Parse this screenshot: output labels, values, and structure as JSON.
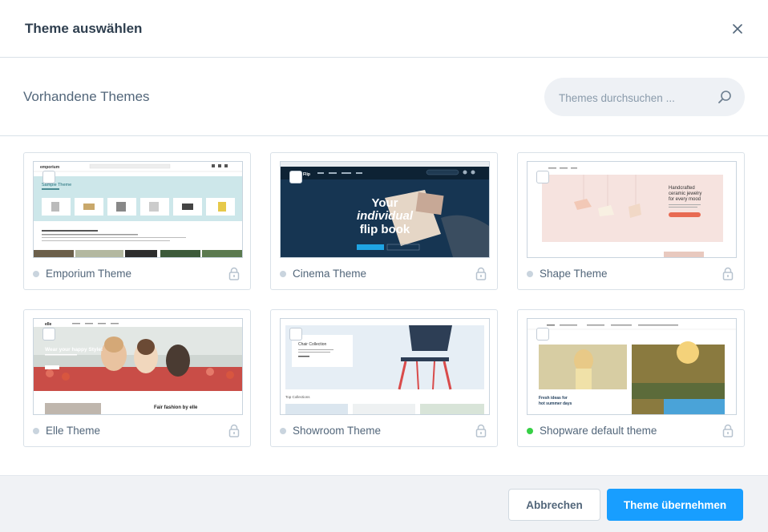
{
  "modal": {
    "title": "Theme auswählen",
    "section_title": "Vorhandene Themes",
    "search": {
      "placeholder": "Themes durchsuchen ..."
    },
    "colors": {
      "primary": "#189eff",
      "active_dot": "#37d046",
      "inactive_dot": "#c9d4de"
    },
    "footer": {
      "cancel_label": "Abbrechen",
      "apply_label": "Theme übernehmen"
    }
  },
  "themes": [
    {
      "name": "Emporium Theme",
      "active": false,
      "locked": true,
      "preview": {
        "logo": "emporium",
        "heading": "Sample Theme"
      }
    },
    {
      "name": "Cinema Theme",
      "active": false,
      "locked": true,
      "preview": {
        "logo": "Flip",
        "line1": "Your",
        "line2": "individual",
        "line3": "flip book"
      }
    },
    {
      "name": "Shape Theme",
      "active": false,
      "locked": true,
      "preview": {
        "line1": "Handcrafted",
        "line2": "ceramic jewelry",
        "line3": "for every mood"
      }
    },
    {
      "name": "Elle Theme",
      "active": false,
      "locked": true,
      "preview": {
        "logo": "elle",
        "line1": "Wear your happy Style!",
        "caption": "Fair fashion by elle"
      }
    },
    {
      "name": "Showroom Theme",
      "active": false,
      "locked": true,
      "preview": {
        "box_title": "Chair Collection",
        "section": "Top Collections"
      }
    },
    {
      "name": "Shopware default theme",
      "active": true,
      "locked": true,
      "preview": {
        "line1": "Fresh ideas for",
        "line2": "hot summer days"
      }
    }
  ]
}
